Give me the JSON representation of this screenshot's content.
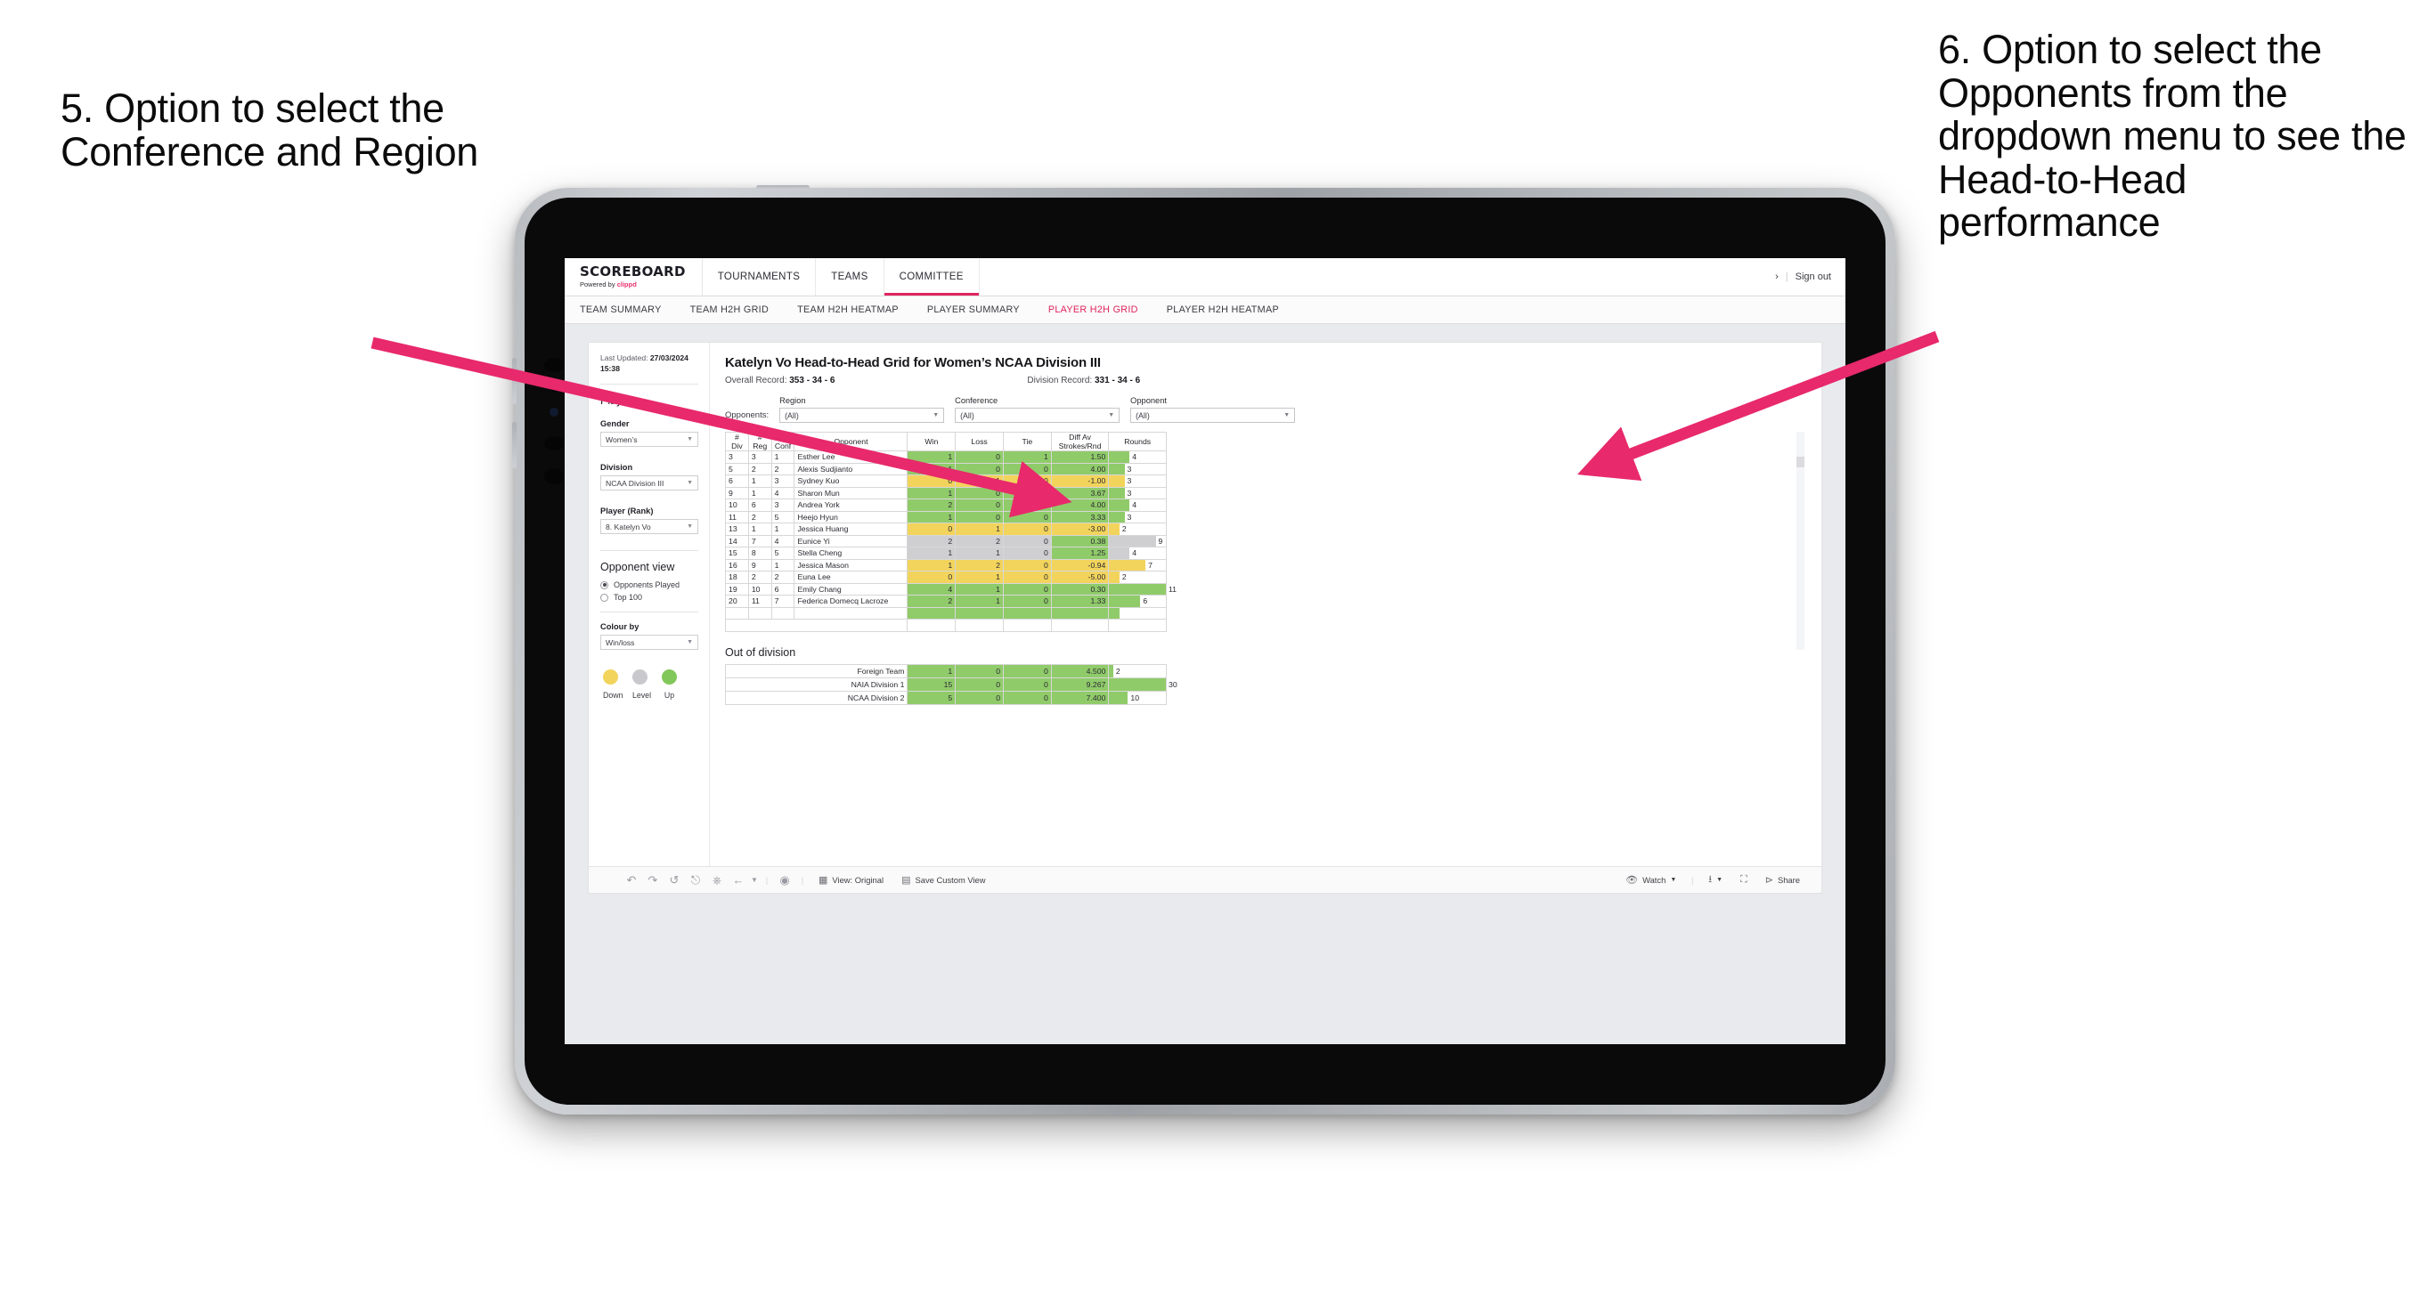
{
  "annotations": {
    "left": "5. Option to select the Conference and Region",
    "right": "6. Option to select the Opponents from the dropdown menu to see the Head-to-Head performance",
    "arrow_color": "#e8296b"
  },
  "app": {
    "brand": {
      "title": "SCOREBOARD",
      "powered_prefix": "Powered by ",
      "powered_brand": "clippd"
    },
    "topnav": [
      {
        "label": "TOURNAMENTS",
        "active": false
      },
      {
        "label": "TEAMS",
        "active": false
      },
      {
        "label": "COMMITTEE",
        "active": true
      }
    ],
    "topbar_right": {
      "chevron": "›",
      "sep": "|",
      "sign_out": "Sign out"
    },
    "subnav": [
      {
        "label": "TEAM SUMMARY",
        "active": false
      },
      {
        "label": "TEAM H2H GRID",
        "active": false
      },
      {
        "label": "TEAM H2H HEATMAP",
        "active": false
      },
      {
        "label": "PLAYER SUMMARY",
        "active": false
      },
      {
        "label": "PLAYER H2H GRID",
        "active": true
      },
      {
        "label": "PLAYER H2H HEATMAP",
        "active": false
      }
    ]
  },
  "sidebar": {
    "last_updated_label": "Last Updated: ",
    "last_updated_value": "27/03/2024",
    "last_updated_time": "15:38",
    "section_player": "Player",
    "gender_label": "Gender",
    "gender_value": "Women’s",
    "division_label": "Division",
    "division_value": "NCAA Division III",
    "player_rank_label": "Player (Rank)",
    "player_rank_value": "8. Katelyn Vo",
    "opponent_view_label": "Opponent view",
    "opponent_view_options": [
      {
        "label": "Opponents Played",
        "selected": true
      },
      {
        "label": "Top 100",
        "selected": false
      }
    ],
    "colour_by_label": "Colour by",
    "colour_by_value": "Win/loss",
    "legend": [
      {
        "label": "Down",
        "color": "#f2d45c"
      },
      {
        "label": "Level",
        "color": "#c9c9cd"
      },
      {
        "label": "Up",
        "color": "#82c75a"
      }
    ]
  },
  "main": {
    "title": "Katelyn Vo Head-to-Head Grid for Women’s NCAA Division III",
    "overall_record_label": "Overall Record: ",
    "overall_record_value": "353 -  34 - 6",
    "division_record_label": "Division Record: ",
    "division_record_value": "331 -  34 - 6",
    "filters_prefix": "Opponents:",
    "filters": [
      {
        "label": "Region",
        "value": "(All)"
      },
      {
        "label": "Conference",
        "value": "(All)"
      },
      {
        "label": "Opponent",
        "value": "(All)"
      }
    ],
    "out_of_division_heading": "Out of division"
  },
  "chart_data": {
    "type": "table",
    "title": "Katelyn Vo Head-to-Head Grid for Women’s NCAA Division III",
    "columns": [
      "# Div",
      "# Reg",
      "# Conf",
      "Opponent",
      "Win",
      "Loss",
      "Tie",
      "Diff Av Strokes/Rnd",
      "Rounds"
    ],
    "column_headers_two_line": {
      "div": [
        "#",
        "Div"
      ],
      "reg": [
        "#",
        "Reg"
      ],
      "conf": [
        "#",
        "Conf"
      ],
      "opponent": [
        "Opponent"
      ],
      "win": [
        "Win"
      ],
      "loss": [
        "Loss"
      ],
      "tie": [
        "Tie"
      ],
      "diff": [
        "Diff Av",
        "Strokes/Rnd"
      ],
      "rounds": [
        "Rounds"
      ]
    },
    "rounds_max": 11,
    "rows": [
      {
        "div": "3",
        "reg": "3",
        "conf": "1",
        "opponent": "Esther Lee",
        "win": "1",
        "loss": "0",
        "tie": "1",
        "diff": "1.50",
        "rounds": 4,
        "state": "up"
      },
      {
        "div": "5",
        "reg": "2",
        "conf": "2",
        "opponent": "Alexis Sudjianto",
        "win": "1",
        "loss": "0",
        "tie": "0",
        "diff": "4.00",
        "rounds": 3,
        "state": "up"
      },
      {
        "div": "6",
        "reg": "1",
        "conf": "3",
        "opponent": "Sydney Kuo",
        "win": "0",
        "loss": "1",
        "tie": "0",
        "diff": "-1.00",
        "rounds": 3,
        "state": "down"
      },
      {
        "div": "9",
        "reg": "1",
        "conf": "4",
        "opponent": "Sharon Mun",
        "win": "1",
        "loss": "0",
        "tie": "0",
        "diff": "3.67",
        "rounds": 3,
        "state": "up"
      },
      {
        "div": "10",
        "reg": "6",
        "conf": "3",
        "opponent": "Andrea York",
        "win": "2",
        "loss": "0",
        "tie": "0",
        "diff": "4.00",
        "rounds": 4,
        "state": "up"
      },
      {
        "div": "11",
        "reg": "2",
        "conf": "5",
        "opponent": "Heejo Hyun",
        "win": "1",
        "loss": "0",
        "tie": "0",
        "diff": "3.33",
        "rounds": 3,
        "state": "up"
      },
      {
        "div": "13",
        "reg": "1",
        "conf": "1",
        "opponent": "Jessica Huang",
        "win": "0",
        "loss": "1",
        "tie": "0",
        "diff": "-3.00",
        "rounds": 2,
        "state": "down"
      },
      {
        "div": "14",
        "reg": "7",
        "conf": "4",
        "opponent": "Eunice Yi",
        "win": "2",
        "loss": "2",
        "tie": "0",
        "diff": "0.38",
        "rounds": 9,
        "state": "level",
        "diff_state": "up"
      },
      {
        "div": "15",
        "reg": "8",
        "conf": "5",
        "opponent": "Stella Cheng",
        "win": "1",
        "loss": "1",
        "tie": "0",
        "diff": "1.25",
        "rounds": 4,
        "state": "level",
        "diff_state": "up"
      },
      {
        "div": "16",
        "reg": "9",
        "conf": "1",
        "opponent": "Jessica Mason",
        "win": "1",
        "loss": "2",
        "tie": "0",
        "diff": "-0.94",
        "rounds": 7,
        "state": "down"
      },
      {
        "div": "18",
        "reg": "2",
        "conf": "2",
        "opponent": "Euna Lee",
        "win": "0",
        "loss": "1",
        "tie": "0",
        "diff": "-5.00",
        "rounds": 2,
        "state": "down"
      },
      {
        "div": "19",
        "reg": "10",
        "conf": "6",
        "opponent": "Emily Chang",
        "win": "4",
        "loss": "1",
        "tie": "0",
        "diff": "0.30",
        "rounds": 11,
        "state": "up"
      },
      {
        "div": "20",
        "reg": "11",
        "conf": "7",
        "opponent": "Federica Domecq Lacroze",
        "win": "2",
        "loss": "1",
        "tie": "0",
        "diff": "1.33",
        "rounds": 6,
        "state": "up"
      }
    ],
    "out_of_division": {
      "rounds_max": 30,
      "rows": [
        {
          "name": "Foreign Team",
          "win": "1",
          "loss": "0",
          "tie": "0",
          "diff": "4.500",
          "rounds": 2,
          "state": "up"
        },
        {
          "name": "NAIA Division 1",
          "win": "15",
          "loss": "0",
          "tie": "0",
          "diff": "9.267",
          "rounds": 30,
          "state": "up"
        },
        {
          "name": "NCAA Division 2",
          "win": "5",
          "loss": "0",
          "tie": "0",
          "diff": "7.400",
          "rounds": 10,
          "state": "up"
        }
      ]
    }
  },
  "toolbar": {
    "icons": [
      "undo-icon",
      "redo-icon",
      "revert-icon",
      "refresh-icon",
      "pause-icon",
      "back-icon"
    ],
    "view_label": "View: Original",
    "save_custom_view_label": "Save Custom View",
    "watch_label": "Watch",
    "share_label": "Share"
  }
}
